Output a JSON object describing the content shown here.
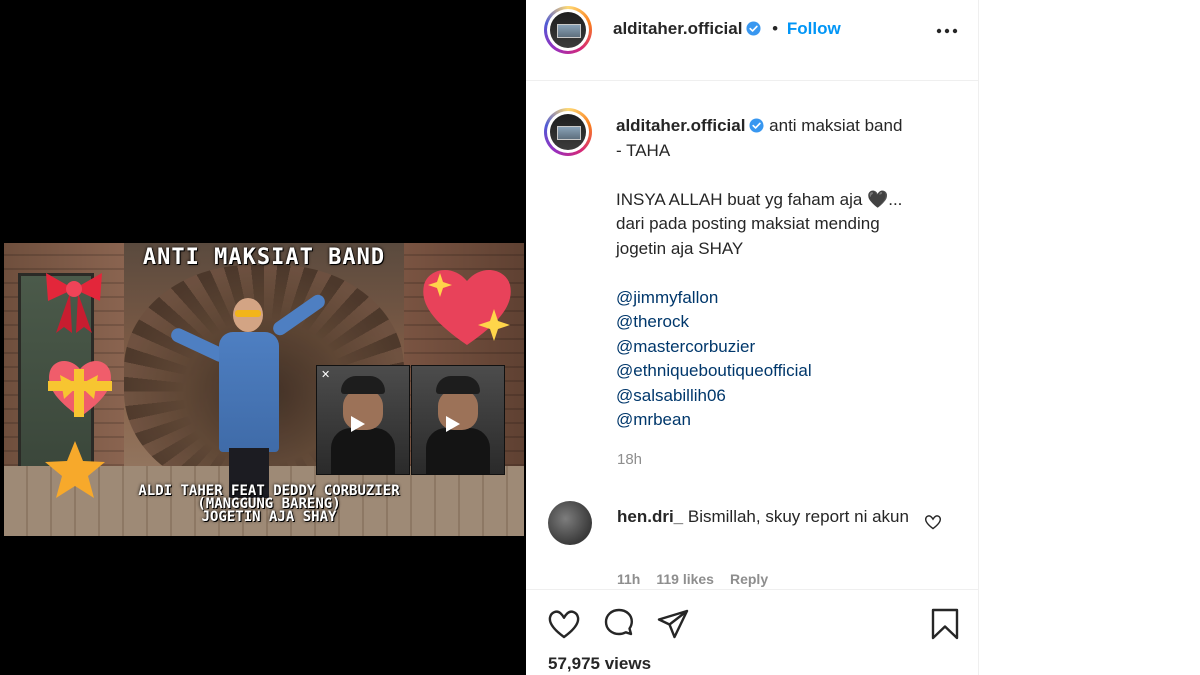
{
  "media": {
    "overlay_title": "ANTI MAKSIAT BAND",
    "overlay_subtitle_lines": [
      "ALDI TAHER FEAT DEDDY CORBUZIER",
      "(MANGGUNG BARENG)",
      "JOGETIN AJA SHAY"
    ]
  },
  "post": {
    "username": "alditaher.official",
    "follow_label": "Follow",
    "separator": "•",
    "caption": {
      "username": "alditaher.official",
      "first_line_text": "anti maksiat band",
      "second_line": "- TAHA",
      "body_lines": [
        "INSYA ALLAH buat yg faham aja 🖤...",
        "dari pada posting maksiat mending",
        "jogetin aja SHAY"
      ],
      "mentions": [
        "@jimmyfallon",
        "@therock",
        "@mastercorbuzier",
        "@ethniqueboutiqueofficial",
        "@salsabillih06",
        "@mrbean"
      ],
      "time": "18h"
    },
    "comment": {
      "username": "hen.dri_",
      "text": "Bismillah, skuy report ni akun",
      "time": "11h",
      "likes": "119 likes",
      "reply": "Reply"
    },
    "views": "57,975 views",
    "accent_color": "#0095f6",
    "mention_color": "#00376b"
  }
}
